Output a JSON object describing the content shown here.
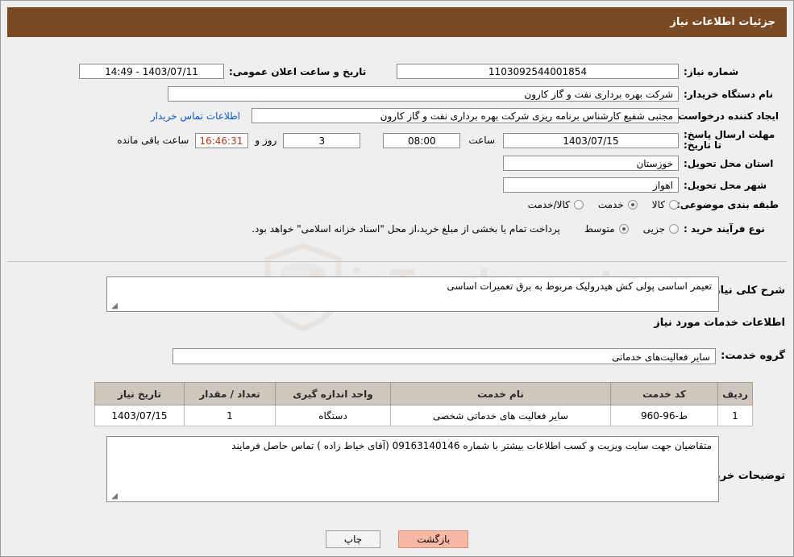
{
  "header": {
    "title": "جزئیات اطلاعات نیاز"
  },
  "watermark": {
    "text": "AriaTender.net"
  },
  "form": {
    "need_number_label": "شماره نیاز:",
    "need_number_value": "1103092544001854",
    "public_date_label": "تاریخ و ساعت اعلان عمومی:",
    "public_date_value": "1403/07/11 - 14:49",
    "buyer_org_label": "نام دستگاه خریدار:",
    "buyer_org_value": "شرکت بهره برداری نفت و گاز کارون",
    "requester_label": "ایجاد کننده درخواست:",
    "requester_value": "مجتبی شفیع کارشناس برنامه ریزی شرکت بهره برداری نفت و گاز کارون",
    "buyer_contact_link": "اطلاعات تماس خریدار",
    "deadline_label": "مهلت ارسال پاسخ: تا تاریخ:",
    "deadline_date_value": "1403/07/15",
    "hour_label": "ساعت",
    "hour_value": "08:00",
    "days_value": "3",
    "days_label": "روز و",
    "timer_value": "16:46:31",
    "timer_label": "ساعت باقی مانده",
    "province_label": "استان محل تحویل:",
    "province_value": "خوزستان",
    "city_label": "شهر محل تحویل:",
    "city_value": "اهواز",
    "category_label": "طبقه بندی موضوعی:",
    "category_options": [
      "کالا",
      "خدمت",
      "کالا/خدمت"
    ],
    "category_selected": "خدمت",
    "process_label": "نوع فرآیند خرید :",
    "process_options": [
      "جزیی",
      "متوسط"
    ],
    "process_selected": "متوسط",
    "process_note": "پرداخت تمام یا بخشی از مبلغ خرید،از محل \"اسناد خزانه اسلامی\" خواهد بود."
  },
  "description": {
    "title": "شرح کلی نیاز:",
    "value": "تعیمر اساسی پولی کش هیدرولیک مربوط به برق تعمیرات اساسی"
  },
  "service_info": {
    "section_title": "اطلاعات خدمات مورد نیاز",
    "group_label": "گروه خدمت:",
    "group_value": "سایر فعالیت‌های خدماتی"
  },
  "table": {
    "headers": [
      "ردیف",
      "کد خدمت",
      "نام خدمت",
      "واحد اندازه گیری",
      "تعداد / مقدار",
      "تاریخ نیاز"
    ],
    "rows": [
      {
        "row_no": "1",
        "service_code": "ط-96-960",
        "service_name": "سایر فعالیت های خدماتی شخصی",
        "unit": "دستگاه",
        "quantity": "1",
        "need_date": "1403/07/15"
      }
    ]
  },
  "buyer_notes": {
    "label": "توضیحات خریدار:",
    "value": "متقاضیان جهت سایت ویزیت و کسب اطلاعات بیشتر با شماره 09163140146 (آقای خیاط زاده ) تماس حاصل فرمایند"
  },
  "footer": {
    "print_label": "چاپ",
    "back_label": "بازگشت"
  }
}
